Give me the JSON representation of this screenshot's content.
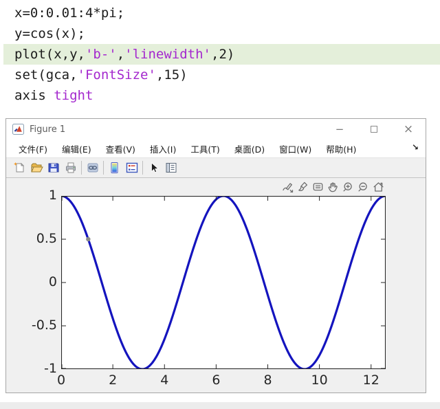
{
  "code": {
    "lines": [
      {
        "highlight": false,
        "segments": [
          {
            "text": "x=0:0.01:4*pi;",
            "type": "code"
          }
        ]
      },
      {
        "highlight": false,
        "segments": [
          {
            "text": "y=cos(x);",
            "type": "code"
          }
        ]
      },
      {
        "highlight": true,
        "segments": [
          {
            "text": "plot(x,y,",
            "type": "code"
          },
          {
            "text": "'b-'",
            "type": "string"
          },
          {
            "text": ",",
            "type": "code"
          },
          {
            "text": "'linewidth'",
            "type": "string"
          },
          {
            "text": ",2)",
            "type": "code"
          }
        ]
      },
      {
        "highlight": false,
        "segments": [
          {
            "text": "set(gca,",
            "type": "code"
          },
          {
            "text": "'FontSize'",
            "type": "string"
          },
          {
            "text": ",15)",
            "type": "code"
          }
        ]
      },
      {
        "highlight": false,
        "segments": [
          {
            "text": "axis ",
            "type": "code"
          },
          {
            "text": "tight",
            "type": "string"
          }
        ]
      }
    ],
    "string_color": "#a428ce",
    "highlight_color": "#e4efda"
  },
  "window": {
    "title": "Figure 1",
    "controls": {
      "minimize": "−",
      "maximize": "",
      "close": "×"
    },
    "menu_items": [
      {
        "id": "file",
        "label": "文件(F)"
      },
      {
        "id": "edit",
        "label": "编辑(E)"
      },
      {
        "id": "view",
        "label": "查看(V)"
      },
      {
        "id": "insert",
        "label": "插入(I)"
      },
      {
        "id": "tools",
        "label": "工具(T)"
      },
      {
        "id": "desktop",
        "label": "桌面(D)"
      },
      {
        "id": "window",
        "label": "窗口(W)"
      },
      {
        "id": "help",
        "label": "帮助(H)"
      }
    ],
    "dock_arrow": "↘",
    "toolbar_icons": [
      "new-figure-icon",
      "open-file-icon",
      "save-figure-icon",
      "print-figure-icon",
      "link-plot-icon",
      "insert-colorbar-icon",
      "insert-legend-icon",
      "edit-plot-icon",
      "property-editor-icon"
    ],
    "axes_toolbar_icons": [
      "export-icon",
      "brush-icon",
      "datatips-icon",
      "pan-icon",
      "zoom-in-icon",
      "zoom-out-icon",
      "restore-view-home-icon"
    ]
  },
  "chart_data": {
    "type": "line",
    "title": "",
    "xlabel": "",
    "ylabel": "",
    "xlim": [
      0,
      12.566
    ],
    "ylim": [
      -1,
      1
    ],
    "xticks": [
      0,
      2,
      4,
      6,
      8,
      10,
      12
    ],
    "xtick_labels": [
      "0",
      "2",
      "4",
      "6",
      "8",
      "10",
      "12"
    ],
    "yticks": [
      1,
      0.5,
      0,
      -0.5,
      -1
    ],
    "ytick_labels": [
      "1",
      "0.5",
      "0",
      "-0.5",
      "-1"
    ],
    "grid": false,
    "box": true,
    "axes_font_size": 15,
    "axis_color": "#262626",
    "series": [
      {
        "name": "y=cos(x)",
        "function": "cos",
        "x_start": 0,
        "x_end": 12.566,
        "x_step": 0.02,
        "color": "#1414be",
        "linewidth": 2
      }
    ],
    "marker": {
      "x": 1.047,
      "y": 0.5,
      "color": "#8a8a8a"
    }
  }
}
